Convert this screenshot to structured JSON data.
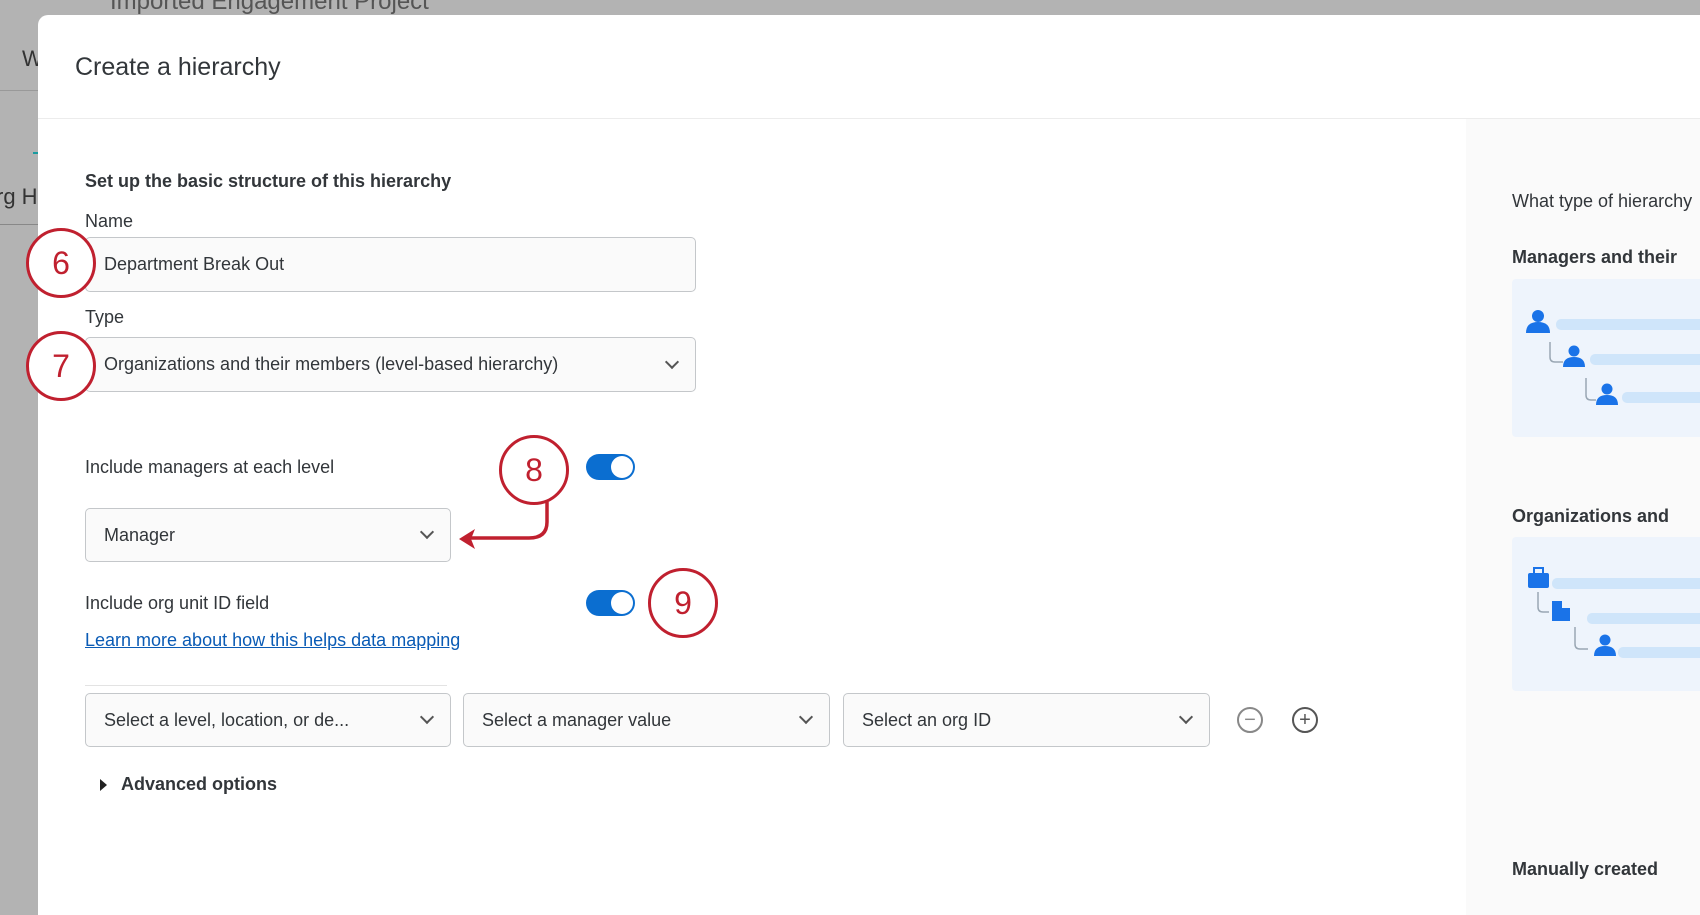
{
  "background": {
    "page_title": "Imported Engagement Project",
    "tab_fragment": "W",
    "row_fragment": "rg H"
  },
  "modal": {
    "title": "Create a hierarchy",
    "section_title": "Set up the basic structure of this hierarchy",
    "name_label": "Name",
    "name_value": "Department Break Out",
    "type_label": "Type",
    "type_value": "Organizations and their members (level-based hierarchy)",
    "include_managers_label": "Include managers at each level",
    "include_managers_on": true,
    "manager_select_value": "Manager",
    "include_org_unit_label": "Include org unit ID field",
    "include_org_unit_on": true,
    "learn_more_link": "Learn more about how this helps data mapping",
    "mapping_row": {
      "level_placeholder": "Select a level, location, or de...",
      "manager_placeholder": "Select a manager value",
      "org_id_placeholder": "Select an org ID",
      "remove_symbol": "−",
      "add_symbol": "+"
    },
    "advanced_options": "Advanced options"
  },
  "right_panel": {
    "question": "What type of hierarchy",
    "option1_title": "Managers and their",
    "option2_title": "Organizations and",
    "option3_title": "Manually created"
  },
  "annotations": [
    "6",
    "7",
    "8",
    "9"
  ],
  "colors": {
    "accent": "#0b6ed0",
    "annotation": "#c0202f",
    "icon": "#1a73e8"
  }
}
